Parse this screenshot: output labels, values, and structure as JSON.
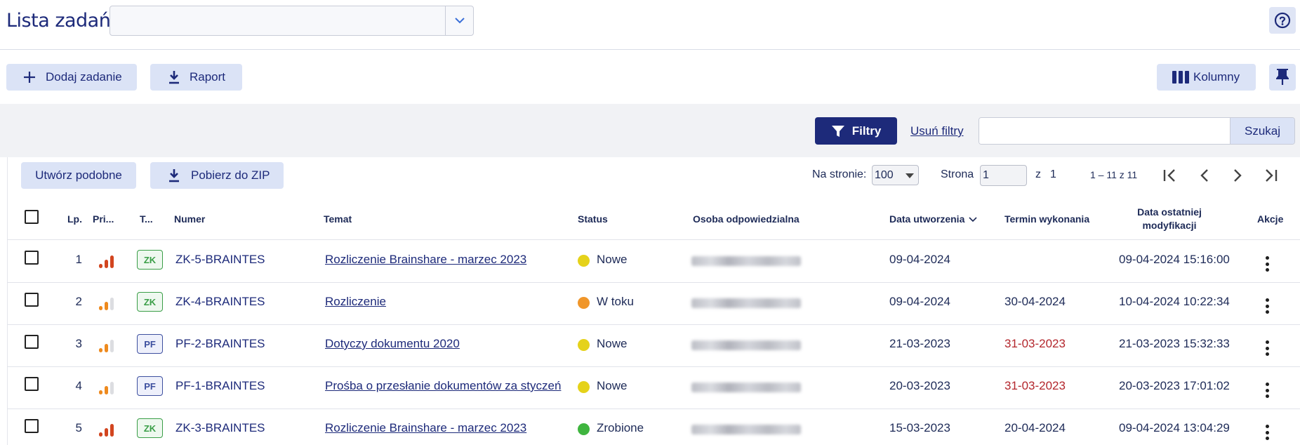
{
  "header": {
    "title": "Lista zadań",
    "project_select_value": "",
    "help_icon": "question-circle-icon"
  },
  "toolbar": {
    "add_task_label": "Dodaj zadanie",
    "report_label": "Raport",
    "columns_label": "Kolumny",
    "pin_icon": "pin-icon"
  },
  "filters": {
    "filter_label": "Filtry",
    "clear_label": "Usuń filtry",
    "search_value": "",
    "search_button": "Szukaj"
  },
  "actions": {
    "create_similar": "Utwórz podobne",
    "download_zip": "Pobierz do ZIP"
  },
  "pagination": {
    "per_page_label": "Na stronie:",
    "per_page_value": "100",
    "page_label": "Strona",
    "page_value": "1",
    "of_label": "z",
    "total_pages": "1",
    "range_text": "1 – 11 z 11"
  },
  "columns": {
    "lp": "Lp.",
    "priority": "Pri...",
    "type": "T...",
    "number": "Numer",
    "subject": "Temat",
    "status": "Status",
    "responsible": "Osoba odpowiedzialna",
    "created": "Data utworzenia",
    "due": "Termin wykonania",
    "modified_line1": "Data ostatniej",
    "modified_line2": "modyfikacji",
    "actions": "Akcje"
  },
  "colors": {
    "primary": "#1d2a7a",
    "accent_light": "#dbe3f6",
    "status_new": "#e5d21a",
    "status_in_progress": "#f0962a",
    "status_done": "#3fb53f",
    "overdue": "#b3262c"
  },
  "rows": [
    {
      "lp": "1",
      "priority": 3,
      "type": "ZK",
      "number": "ZK-5-BRAINTES",
      "subject": "Rozliczenie Brainshare - marzec 2023",
      "status": "Nowe",
      "status_color": "#e5d21a",
      "created": "09-04-2024",
      "due": "",
      "due_overdue": false,
      "modified": "09-04-2024 15:16:00"
    },
    {
      "lp": "2",
      "priority": 2,
      "type": "ZK",
      "number": "ZK-4-BRAINTES",
      "subject": "Rozliczenie",
      "status": "W toku",
      "status_color": "#f0962a",
      "created": "09-04-2024",
      "due": "30-04-2024",
      "due_overdue": false,
      "modified": "10-04-2024 10:22:34"
    },
    {
      "lp": "3",
      "priority": 2,
      "type": "PF",
      "number": "PF-2-BRAINTES",
      "subject": "Dotyczy dokumentu 2020",
      "status": "Nowe",
      "status_color": "#e5d21a",
      "created": "21-03-2023",
      "due": "31-03-2023",
      "due_overdue": true,
      "modified": "21-03-2023 15:32:33"
    },
    {
      "lp": "4",
      "priority": 2,
      "type": "PF",
      "number": "PF-1-BRAINTES",
      "subject": "Prośba o przesłanie dokumentów za styczeń",
      "status": "Nowe",
      "status_color": "#e5d21a",
      "created": "20-03-2023",
      "due": "31-03-2023",
      "due_overdue": true,
      "modified": "20-03-2023 17:01:02"
    },
    {
      "lp": "5",
      "priority": 3,
      "type": "ZK",
      "number": "ZK-3-BRAINTES",
      "subject": "Rozliczenie Brainshare - marzec 2023",
      "status": "Zrobione",
      "status_color": "#3fb53f",
      "created": "15-03-2023",
      "due": "20-04-2024",
      "due_overdue": false,
      "modified": "09-04-2024 13:04:29"
    }
  ]
}
